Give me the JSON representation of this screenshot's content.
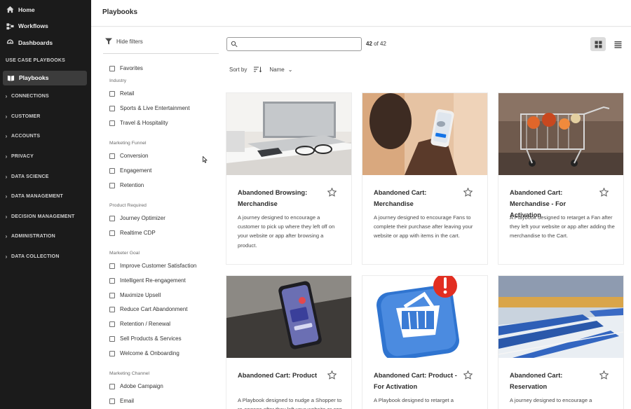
{
  "sidebar": {
    "nav": [
      {
        "label": "Home",
        "icon": "home-icon"
      },
      {
        "label": "Workflows",
        "icon": "workflow-icon"
      },
      {
        "label": "Dashboards",
        "icon": "dashboard-icon"
      }
    ],
    "section_use_case": "USE CASE PLAYBOOKS",
    "active_item": "Playbooks",
    "sections": [
      "CONNECTIONS",
      "CUSTOMER",
      "ACCOUNTS",
      "PRIVACY",
      "DATA SCIENCE",
      "DATA MANAGEMENT",
      "DECISION MANAGEMENT",
      "ADMINISTRATION",
      "DATA COLLECTION"
    ]
  },
  "header": {
    "title": "Playbooks"
  },
  "filters": {
    "hide_label": "Hide filters",
    "favorites": "Favorites",
    "groups": [
      {
        "title": "Industry",
        "items": [
          "Retail",
          "Sports & Live Entertainment",
          "Travel & Hospitality"
        ]
      },
      {
        "title": "Marketing Funnel",
        "items": [
          "Conversion",
          "Engagement",
          "Retention"
        ]
      },
      {
        "title": "Product Required",
        "items": [
          "Journey Optimizer",
          "Realtime CDP"
        ]
      },
      {
        "title": "Marketer Goal",
        "items": [
          "Improve Customer Satisfaction",
          "Intelligent Re-engagement",
          "Maximize Upsell",
          "Reduce Cart Abandonment",
          "Retention / Renewal",
          "Sell Products & Services",
          "Welcome & Onboarding"
        ]
      },
      {
        "title": "Marketing Channel",
        "items": [
          "Adobe Campaign",
          "Email"
        ]
      }
    ]
  },
  "toolbar": {
    "search_placeholder": "",
    "count_shown": "42",
    "count_of": "of 42",
    "sort_label": "Sort by",
    "sort_value": "Name"
  },
  "cards": [
    {
      "title": "Abandoned Browsing: Merchandise",
      "desc": "A journey designed to encourage a customer to pick up where they left off on your website or app after browsing a product."
    },
    {
      "title": "Abandoned Cart: Merchandise",
      "desc": "A journey designed to encourage Fans to complete their purchase after leaving your website or app with items in the cart."
    },
    {
      "title": "Abandoned Cart: Merchandise - For Activation",
      "desc": "A Playbook designed to retarget a Fan after they left your website or app after adding the merchandise to the Cart."
    },
    {
      "title": "Abandoned Cart: Product",
      "desc": "A Playbook designed to nudge a Shopper to re-engage after they left your website or app after adding"
    },
    {
      "title": "Abandoned Cart: Product - For Activation",
      "desc": "A Playbook designed to retarget a"
    },
    {
      "title": "Abandoned Cart: Reservation",
      "desc": "A journey designed to encourage a"
    }
  ],
  "colors": {
    "sidebar_bg": "#1b1b1b",
    "accent_blue": "#1473e6",
    "badge_red": "#e22e21"
  }
}
